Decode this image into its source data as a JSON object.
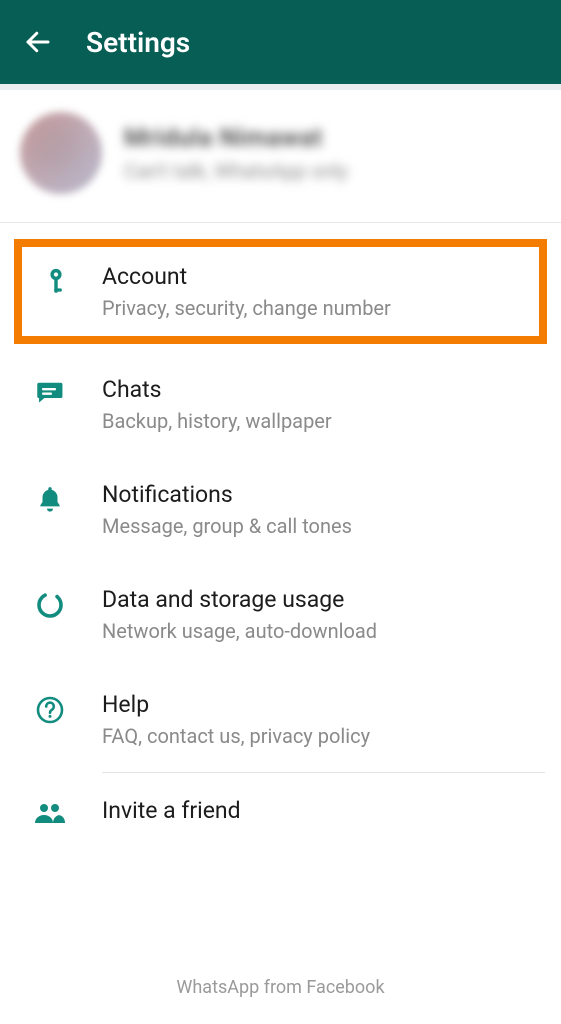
{
  "header": {
    "title": "Settings"
  },
  "profile": {
    "name": "Mridula Nimawat",
    "status": "Can't talk, WhatsApp only"
  },
  "items": {
    "account": {
      "title": "Account",
      "sub": "Privacy, security, change number"
    },
    "chats": {
      "title": "Chats",
      "sub": "Backup, history, wallpaper"
    },
    "notifications": {
      "title": "Notifications",
      "sub": "Message, group & call tones"
    },
    "data": {
      "title": "Data and storage usage",
      "sub": "Network usage, auto-download"
    },
    "help": {
      "title": "Help",
      "sub": "FAQ, contact us, privacy policy"
    },
    "invite": {
      "title": "Invite a friend"
    }
  },
  "footer": {
    "text": "WhatsApp from Facebook"
  },
  "colors": {
    "teal": "#128c7e",
    "tealDark": "#075e54",
    "highlight": "#f47c00"
  }
}
